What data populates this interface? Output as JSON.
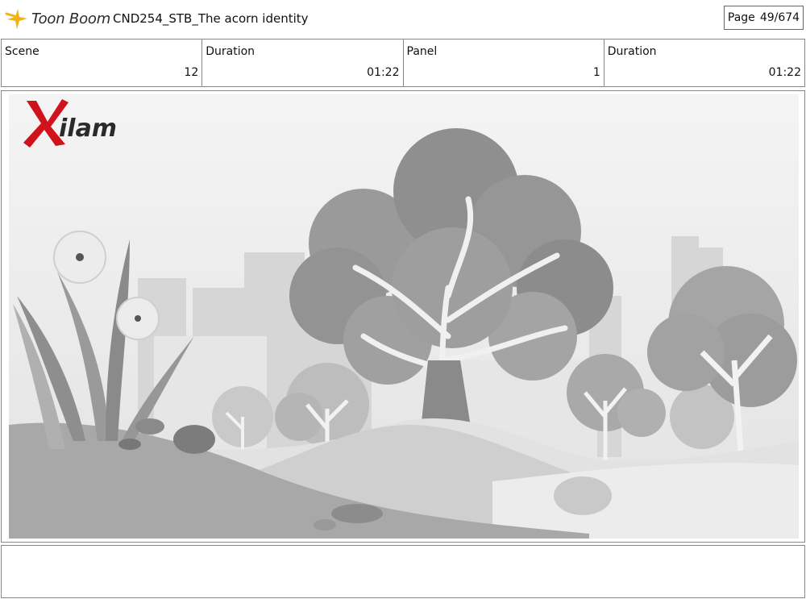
{
  "header": {
    "logo_text": "Toon Boom",
    "title": "CND254_STB_The acorn identity",
    "page_label": "Page",
    "page_value": "49/674"
  },
  "info": {
    "scene_label": "Scene",
    "scene_value": "12",
    "duration1_label": "Duration",
    "duration1_value": "01:22",
    "panel_label": "Panel",
    "panel_value": "1",
    "duration2_label": "Duration",
    "duration2_value": "01:22"
  },
  "panel_image": {
    "watermark_text": "Xilam",
    "watermark_color": "#d0121b"
  },
  "notes": {
    "text": ""
  }
}
